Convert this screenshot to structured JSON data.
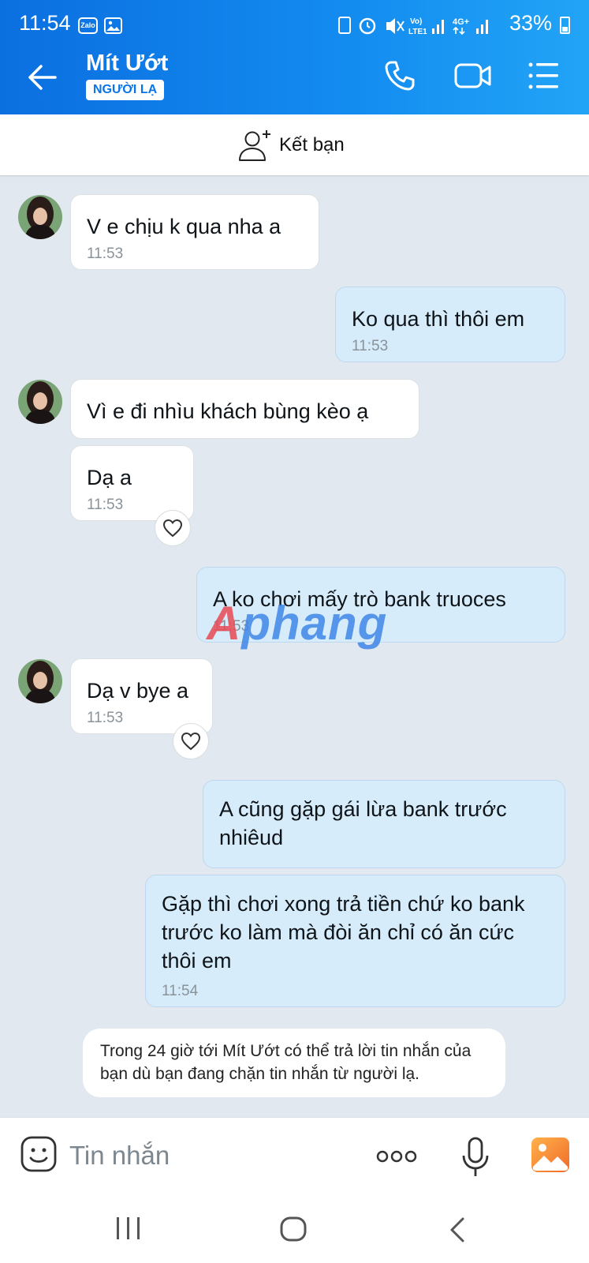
{
  "status_bar": {
    "time": "11:54",
    "zalo_badge": "Zalo",
    "network": "Vo) LTE1 4G+",
    "battery": "33%"
  },
  "header": {
    "contact_name": "Mít Ướt",
    "badge": "NGƯỜI LẠ"
  },
  "add_friend": {
    "label": "Kết bạn"
  },
  "messages": [
    {
      "side": "in",
      "text": "V e chịu k qua nha a",
      "time": "11:53"
    },
    {
      "side": "out",
      "text": "Ko qua thì thôi em",
      "time": "11:53"
    },
    {
      "side": "in",
      "text": "Vì e đi nhìu khách bùng kèo ạ",
      "time": ""
    },
    {
      "side": "in",
      "text": "Dạ a",
      "time": "11:53"
    },
    {
      "side": "out",
      "text": "A ko chơi mấy trò bank truoces",
      "time": "11:53"
    },
    {
      "side": "in",
      "text": "Dạ v bye a",
      "time": "11:53"
    },
    {
      "side": "out",
      "text": "A cũng gặp gái lừa bank trước nhiêud",
      "time": ""
    },
    {
      "side": "out",
      "text": "Gặp thì chơi xong trả tiền chứ ko bank trước ko làm mà đòi ăn chỉ có ăn cức thôi em",
      "time": "11:54"
    }
  ],
  "watermark": {
    "first": "A",
    "rest": "phang"
  },
  "notice": "Trong 24 giờ tới Mít Ướt có thể trả lời tin nhắn của bạn dù bạn đang chặn tin nhắn từ người lạ.",
  "input": {
    "placeholder": "Tin nhắn"
  },
  "colors": {
    "header_start": "#0b6fe0",
    "header_end": "#22a4f6",
    "outgoing_bubble": "#d6ecfb",
    "incoming_bubble": "#ffffff",
    "chat_bg": "#e2e8ef"
  }
}
